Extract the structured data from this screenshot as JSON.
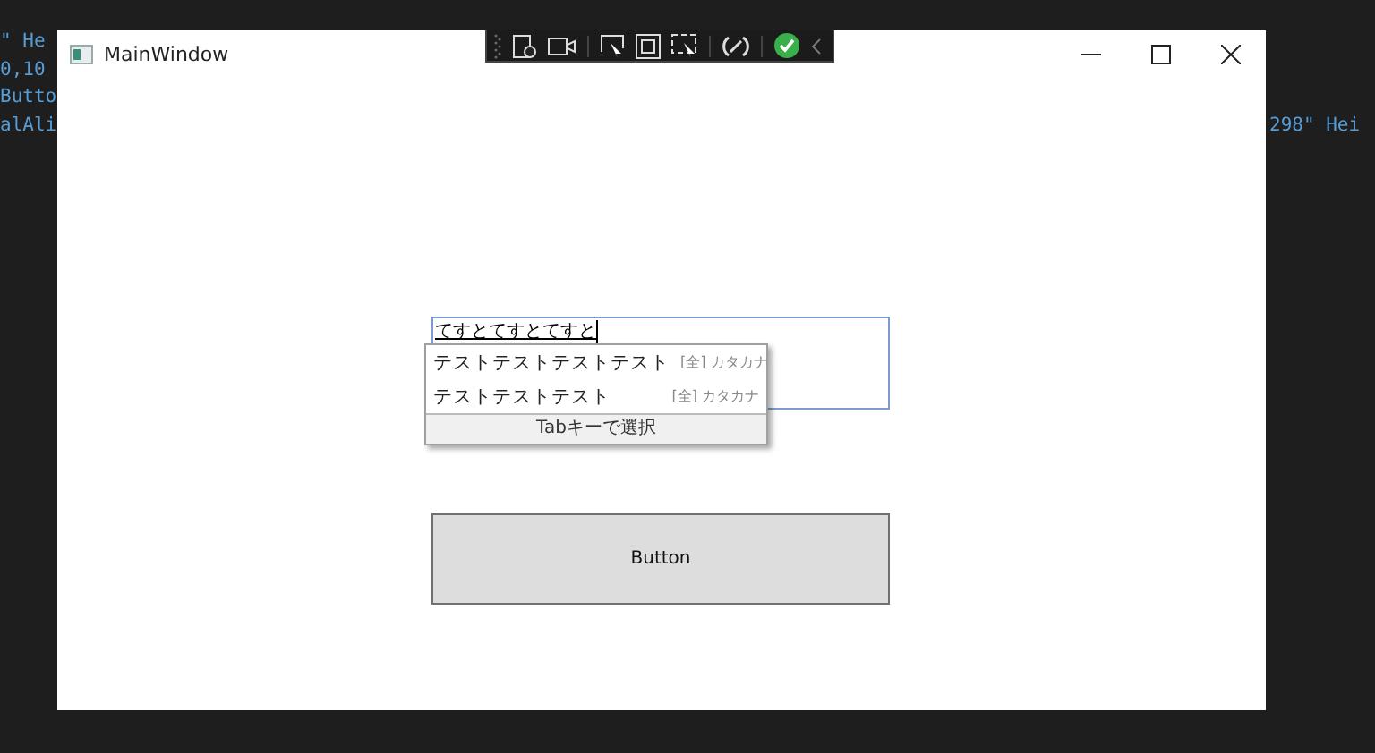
{
  "editor": {
    "left_lines": [
      "\" He",
      "0,10",
      "Butto",
      "alAli"
    ],
    "right_line": "298\" Hei"
  },
  "window": {
    "title": "MainWindow"
  },
  "text_box": {
    "value": "てすとてすとてすと"
  },
  "ime_candidates": {
    "items": [
      {
        "text": "テストテストテストテスト",
        "annotation": "[全] カタカナ"
      },
      {
        "text": "テストテストテスト",
        "annotation": "[全] カタカナ"
      }
    ],
    "footer": "Tabキーで選択"
  },
  "button": {
    "label": "Button"
  }
}
